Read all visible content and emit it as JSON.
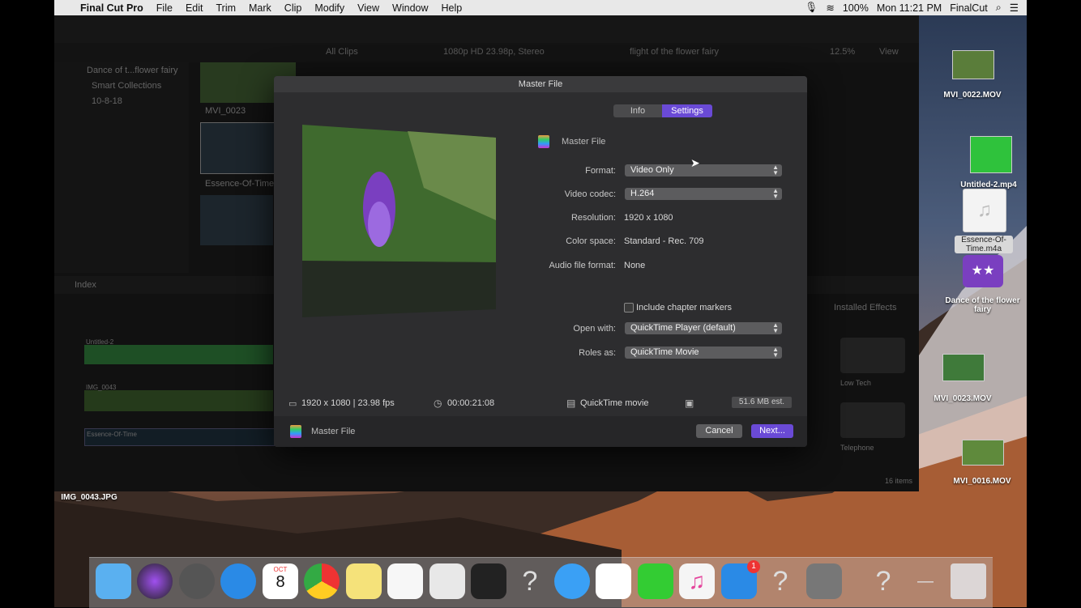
{
  "menubar": {
    "app_name": "Final Cut Pro",
    "items": [
      "File",
      "Edit",
      "Trim",
      "Mark",
      "Clip",
      "Modify",
      "View",
      "Window",
      "Help"
    ],
    "battery": "100%",
    "clock": "Mon 11:21 PM",
    "user": "FinalCut"
  },
  "fcp": {
    "library_name": "Dance of t...flower fairy",
    "smart_collections": "Smart Collections",
    "event": "10-8-18",
    "browser_filter": "All Clips",
    "format_info": "1080p HD 23.98p, Stereo",
    "project_name": "flight of the flower fairy",
    "zoom": "12.5%",
    "view": "View",
    "clip1": "MVI_0023",
    "clip2": "Essence-Of-Time",
    "index": "Index",
    "installed_effects": "Installed Effects",
    "effect1": "Low Tech",
    "effect2": "Telephone",
    "items_count": "16 items",
    "timeline_clip1": "Untitled-2",
    "timeline_clip2": "IMG_0043",
    "timeline_audio": "Essence-Of-Time"
  },
  "dialog": {
    "title": "Master File",
    "tab_info": "Info",
    "tab_settings": "Settings",
    "header": "Master File",
    "fields": {
      "format_label": "Format:",
      "format_value": "Video Only",
      "codec_label": "Video codec:",
      "codec_value": "H.264",
      "resolution_label": "Resolution:",
      "resolution_value": "1920 x 1080",
      "colorspace_label": "Color space:",
      "colorspace_value": "Standard - Rec. 709",
      "audio_label": "Audio file format:",
      "audio_value": "None",
      "chapter_label": "Include chapter markers",
      "chapter_checked": false,
      "open_label": "Open with:",
      "open_value": "QuickTime Player (default)",
      "roles_label": "Roles as:",
      "roles_value": "QuickTime Movie"
    },
    "summary": {
      "dimensions": "1920 x 1080 | 23.98 fps",
      "duration": "00:00:21:08",
      "type": "QuickTime movie",
      "size": "51.6 MB est."
    },
    "footer_label": "Master File",
    "cancel": "Cancel",
    "next": "Next..."
  },
  "desktop": {
    "files": [
      "MVI_0022.MOV",
      "Untitled-2.mp4",
      "Essence-Of-Time.m4a",
      "Dance of the flower fairy",
      "MVI_0023.MOV",
      "MVI_0016.MOV",
      "IMG_0043.JPG"
    ]
  },
  "dock": {
    "calendar_month": "OCT",
    "calendar_day": "8",
    "appstore_badge": "1"
  }
}
